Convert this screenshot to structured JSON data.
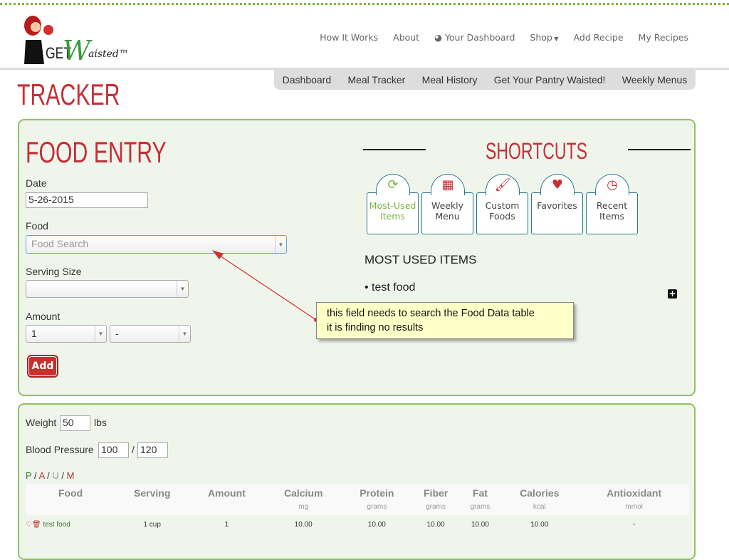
{
  "brand": {
    "logo_text": "GET Waisted™"
  },
  "topnav": [
    "How It Works",
    "About",
    "Your Dashboard",
    "Shop",
    "Add Recipe",
    "My Recipes"
  ],
  "subnav": [
    "Dashboard",
    "Meal Tracker",
    "Meal History",
    "Get Your Pantry Waisted!",
    "Weekly Menus"
  ],
  "page_title": "TRACKER",
  "food_entry": {
    "title": "FOOD ENTRY",
    "date_label": "Date",
    "date_value": "5-26-2015",
    "food_label": "Food",
    "food_placeholder": "Food Search",
    "serving_label": "Serving Size",
    "serving_value": "",
    "amount_label": "Amount",
    "amount_value": "1",
    "amount_fraction": "-",
    "add_label": "Add"
  },
  "shortcuts": {
    "title": "SHORTCUTS",
    "items": [
      {
        "label1": "Most-Used",
        "label2": "Items",
        "icon": "refresh-icon"
      },
      {
        "label1": "Weekly",
        "label2": "Menu",
        "icon": "calendar-icon"
      },
      {
        "label1": "Custom",
        "label2": "Foods",
        "icon": "brush-icon"
      },
      {
        "label1": "Favorites",
        "label2": "",
        "icon": "heart-icon"
      },
      {
        "label1": "Recent",
        "label2": "Items",
        "icon": "clock-icon"
      }
    ],
    "section_title": "MOST USED ITEMS",
    "list": [
      "test food"
    ]
  },
  "annotation": {
    "line1": "this field needs to search the Food Data table",
    "line2": "it is finding no results"
  },
  "stats": {
    "weight_label": "Weight",
    "weight_value": "50",
    "weight_unit": "lbs",
    "bp_label": "Blood Pressure",
    "bp_sys": "100",
    "bp_sep": "/",
    "bp_dia": "120",
    "meal_filter": [
      "P",
      "A",
      "U",
      "M"
    ]
  },
  "table": {
    "headers": [
      "Food",
      "Serving",
      "Amount",
      "Calcium",
      "Protein",
      "Fiber",
      "Fat",
      "Calories",
      "Antioxidant"
    ],
    "units": [
      "",
      "",
      "",
      "mg",
      "grams",
      "grams",
      "grams",
      "kcal",
      "mmol"
    ],
    "rows": [
      [
        "test food",
        "1 cup",
        "1",
        "10.00",
        "10.00",
        "10.00",
        "10.00",
        "10.00",
        "-"
      ]
    ]
  },
  "colors": {
    "accent_red": "#c62f35",
    "green": "#7cb342",
    "panel_bg": "#f0f5ec"
  }
}
